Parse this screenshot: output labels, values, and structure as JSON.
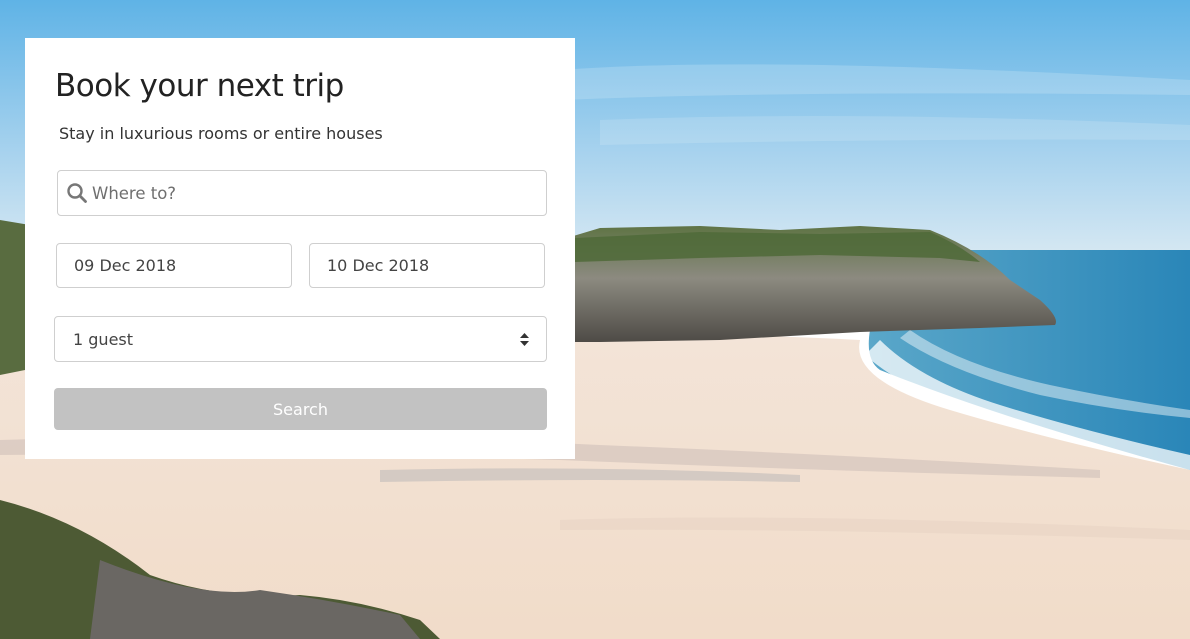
{
  "booking_card": {
    "title": "Book your next trip",
    "subtitle": "Stay in luxurious rooms or entire houses",
    "destination": {
      "placeholder": "Where to?",
      "value": "",
      "icon": "search-icon"
    },
    "check_in": "09 Dec 2018",
    "check_out": "10 Dec 2018",
    "guests": {
      "selected": "1 guest",
      "icon": "select-caret-icon"
    },
    "search_label": "Search"
  },
  "colors": {
    "card_background": "#ffffff",
    "button_disabled": "#c2c2c2",
    "field_border": "#cfcfcf",
    "title_text": "#222222"
  }
}
